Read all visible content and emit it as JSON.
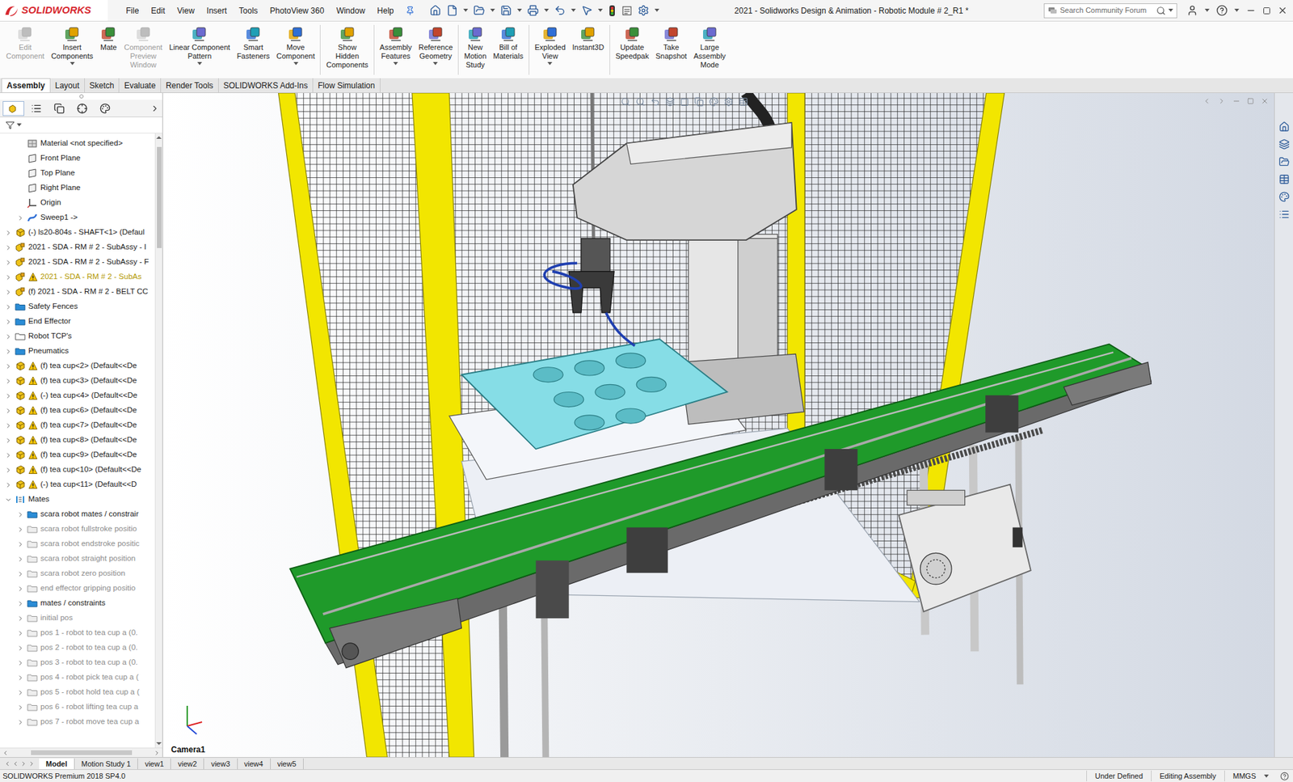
{
  "app": {
    "logo": "SOLIDWORKS"
  },
  "menu": [
    "File",
    "Edit",
    "View",
    "Insert",
    "Tools",
    "PhotoView 360",
    "Window",
    "Help"
  ],
  "window": {
    "title": "2021 - Solidworks Design & Animation - Robotic Module # 2_R1 *"
  },
  "search": {
    "placeholder": "Search Community Forum"
  },
  "ribbon": [
    {
      "lines": [
        "Edit",
        "Component"
      ],
      "disabled": true,
      "has_menu": false,
      "group_start": false
    },
    {
      "lines": [
        "Insert",
        "Components"
      ],
      "disabled": false,
      "has_menu": true,
      "group_start": false
    },
    {
      "lines": [
        "Mate"
      ],
      "disabled": false,
      "has_menu": false,
      "group_start": false
    },
    {
      "lines": [
        "Component",
        "Preview",
        "Window"
      ],
      "disabled": true,
      "has_menu": false,
      "group_start": false
    },
    {
      "lines": [
        "Linear Component",
        "Pattern"
      ],
      "disabled": false,
      "has_menu": true,
      "group_start": false
    },
    {
      "lines": [
        "Smart",
        "Fasteners"
      ],
      "disabled": false,
      "has_menu": false,
      "group_start": false
    },
    {
      "lines": [
        "Move",
        "Component"
      ],
      "disabled": false,
      "has_menu": true,
      "group_start": false
    },
    {
      "lines": [
        "Show",
        "Hidden",
        "Components"
      ],
      "disabled": false,
      "has_menu": false,
      "group_start": true
    },
    {
      "lines": [
        "Assembly",
        "Features"
      ],
      "disabled": false,
      "has_menu": true,
      "group_start": true
    },
    {
      "lines": [
        "Reference",
        "Geometry"
      ],
      "disabled": false,
      "has_menu": true,
      "group_start": false
    },
    {
      "lines": [
        "New",
        "Motion",
        "Study"
      ],
      "disabled": false,
      "has_menu": false,
      "group_start": true
    },
    {
      "lines": [
        "Bill of",
        "Materials"
      ],
      "disabled": false,
      "has_menu": false,
      "group_start": false
    },
    {
      "lines": [
        "Exploded",
        "View"
      ],
      "disabled": false,
      "has_menu": true,
      "group_start": true
    },
    {
      "lines": [
        "Instant3D"
      ],
      "disabled": false,
      "has_menu": false,
      "group_start": false
    },
    {
      "lines": [
        "Update",
        "Speedpak"
      ],
      "disabled": false,
      "has_menu": false,
      "group_start": true
    },
    {
      "lines": [
        "Take",
        "Snapshot"
      ],
      "disabled": false,
      "has_menu": false,
      "group_start": false
    },
    {
      "lines": [
        "Large",
        "Assembly",
        "Mode"
      ],
      "disabled": false,
      "has_menu": false,
      "group_start": false
    }
  ],
  "command_tabs": [
    {
      "label": "Assembly",
      "selected": true
    },
    {
      "label": "Layout",
      "selected": false
    },
    {
      "label": "Sketch",
      "selected": false
    },
    {
      "label": "Evaluate",
      "selected": false
    },
    {
      "label": "Render Tools",
      "selected": false
    },
    {
      "label": "SOLIDWORKS Add-Ins",
      "selected": false
    },
    {
      "label": "Flow Simulation",
      "selected": false
    }
  ],
  "panel_tabs": [
    {
      "selected": true
    },
    {
      "selected": false
    },
    {
      "selected": false
    },
    {
      "selected": false
    },
    {
      "selected": false
    }
  ],
  "tree": [
    {
      "label": "Material <not specified>",
      "kind": "material",
      "level": 1,
      "expander": "none",
      "warning": false,
      "suppressed": false,
      "warn_text": false
    },
    {
      "label": "Front Plane",
      "kind": "plane",
      "level": 1,
      "expander": "none",
      "warning": false,
      "suppressed": false,
      "warn_text": false
    },
    {
      "label": "Top Plane",
      "kind": "plane",
      "level": 1,
      "expander": "none",
      "warning": false,
      "suppressed": false,
      "warn_text": false
    },
    {
      "label": "Right Plane",
      "kind": "plane",
      "level": 1,
      "expander": "none",
      "warning": false,
      "suppressed": false,
      "warn_text": false
    },
    {
      "label": "Origin",
      "kind": "origin",
      "level": 1,
      "expander": "none",
      "warning": false,
      "suppressed": false,
      "warn_text": false
    },
    {
      "label": "Sweep1 ->",
      "kind": "sweep",
      "level": 1,
      "expander": "collapsed",
      "warning": false,
      "suppressed": false,
      "warn_text": false
    },
    {
      "label": "(-) ls20-804s - SHAFT<1> (Defaul",
      "kind": "part",
      "level": 0,
      "expander": "collapsed",
      "warning": false,
      "suppressed": false,
      "warn_text": false
    },
    {
      "label": "2021 - SDA - RM # 2 - SubAssy - I",
      "kind": "assembly",
      "level": 0,
      "expander": "collapsed",
      "warning": false,
      "suppressed": false,
      "warn_text": false
    },
    {
      "label": "2021 - SDA - RM # 2 - SubAssy - F",
      "kind": "assembly",
      "level": 0,
      "expander": "collapsed",
      "warning": false,
      "suppressed": false,
      "warn_text": false
    },
    {
      "label": "2021 - SDA - RM # 2 - SubAs",
      "kind": "assembly",
      "level": 0,
      "expander": "collapsed",
      "warning": true,
      "suppressed": false,
      "warn_text": true
    },
    {
      "label": "(f) 2021 - SDA - RM # 2 - BELT CC",
      "kind": "assembly",
      "level": 0,
      "expander": "collapsed",
      "warning": false,
      "suppressed": false,
      "warn_text": false
    },
    {
      "label": "Safety Fences",
      "kind": "folder",
      "level": 0,
      "expander": "collapsed",
      "warning": false,
      "suppressed": false,
      "warn_text": false
    },
    {
      "label": "End Effector",
      "kind": "folder",
      "level": 0,
      "expander": "collapsed",
      "warning": false,
      "suppressed": false,
      "warn_text": false
    },
    {
      "label": "Robot TCP's",
      "kind": "folder-empty",
      "level": 0,
      "expander": "collapsed",
      "warning": false,
      "suppressed": false,
      "warn_text": false
    },
    {
      "label": "Pneumatics",
      "kind": "folder",
      "level": 0,
      "expander": "collapsed",
      "warning": false,
      "suppressed": false,
      "warn_text": false
    },
    {
      "label": "(f) tea cup<2> (Default<<De",
      "kind": "part",
      "level": 0,
      "expander": "collapsed",
      "warning": true,
      "suppressed": false,
      "warn_text": false
    },
    {
      "label": "(f) tea cup<3> (Default<<De",
      "kind": "part",
      "level": 0,
      "expander": "collapsed",
      "warning": true,
      "suppressed": false,
      "warn_text": false
    },
    {
      "label": "(-) tea cup<4> (Default<<De",
      "kind": "part",
      "level": 0,
      "expander": "collapsed",
      "warning": true,
      "suppressed": false,
      "warn_text": false
    },
    {
      "label": "(f) tea cup<6> (Default<<De",
      "kind": "part",
      "level": 0,
      "expander": "collapsed",
      "warning": true,
      "suppressed": false,
      "warn_text": false
    },
    {
      "label": "(f) tea cup<7> (Default<<De",
      "kind": "part",
      "level": 0,
      "expander": "collapsed",
      "warning": true,
      "suppressed": false,
      "warn_text": false
    },
    {
      "label": "(f) tea cup<8> (Default<<De",
      "kind": "part",
      "level": 0,
      "expander": "collapsed",
      "warning": true,
      "suppressed": false,
      "warn_text": false
    },
    {
      "label": "(f) tea cup<9> (Default<<De",
      "kind": "part",
      "level": 0,
      "expander": "collapsed",
      "warning": true,
      "suppressed": false,
      "warn_text": false
    },
    {
      "label": "(f) tea cup<10> (Default<<De",
      "kind": "part",
      "level": 0,
      "expander": "collapsed",
      "warning": true,
      "suppressed": false,
      "warn_text": false
    },
    {
      "label": "(-) tea cup<11> (Default<<D",
      "kind": "part",
      "level": 0,
      "expander": "collapsed",
      "warning": true,
      "suppressed": false,
      "warn_text": false
    },
    {
      "label": "Mates",
      "kind": "mates",
      "level": 0,
      "expander": "expanded",
      "warning": false,
      "suppressed": false,
      "warn_text": false
    },
    {
      "label": "scara robot mates / constrair",
      "kind": "mate-folder",
      "level": 1,
      "expander": "collapsed",
      "warning": false,
      "suppressed": false,
      "warn_text": false
    },
    {
      "label": "scara robot fullstroke positio",
      "kind": "mate-folder-off",
      "level": 1,
      "expander": "collapsed",
      "warning": false,
      "suppressed": true,
      "warn_text": false
    },
    {
      "label": "scara robot endstroke positic",
      "kind": "mate-folder-off",
      "level": 1,
      "expander": "collapsed",
      "warning": false,
      "suppressed": true,
      "warn_text": false
    },
    {
      "label": "scara robot straight position",
      "kind": "mate-folder-off",
      "level": 1,
      "expander": "collapsed",
      "warning": false,
      "suppressed": true,
      "warn_text": false
    },
    {
      "label": "scara robot zero position",
      "kind": "mate-folder-off",
      "level": 1,
      "expander": "collapsed",
      "warning": false,
      "suppressed": true,
      "warn_text": false
    },
    {
      "label": "end effector gripping positio",
      "kind": "mate-folder-off",
      "level": 1,
      "expander": "collapsed",
      "warning": false,
      "suppressed": true,
      "warn_text": false
    },
    {
      "label": "mates / constraints",
      "kind": "mate-folder",
      "level": 1,
      "expander": "collapsed",
      "warning": false,
      "suppressed": false,
      "warn_text": false
    },
    {
      "label": "initial pos",
      "kind": "mate-folder-off",
      "level": 1,
      "expander": "collapsed",
      "warning": false,
      "suppressed": true,
      "warn_text": false
    },
    {
      "label": "pos 1 - robot to tea cup a (0.",
      "kind": "mate-folder-off",
      "level": 1,
      "expander": "collapsed",
      "warning": false,
      "suppressed": true,
      "warn_text": false
    },
    {
      "label": "pos 2 - robot to tea cup a (0.",
      "kind": "mate-folder-off",
      "level": 1,
      "expander": "collapsed",
      "warning": false,
      "suppressed": true,
      "warn_text": false
    },
    {
      "label": "pos 3 - robot to tea cup a (0.",
      "kind": "mate-folder-off",
      "level": 1,
      "expander": "collapsed",
      "warning": false,
      "suppressed": true,
      "warn_text": false
    },
    {
      "label": "pos 4 - robot pick tea cup a (",
      "kind": "mate-folder-off",
      "level": 1,
      "expander": "collapsed",
      "warning": false,
      "suppressed": true,
      "warn_text": false
    },
    {
      "label": "pos 5 - robot hold tea cup a (",
      "kind": "mate-folder-off",
      "level": 1,
      "expander": "collapsed",
      "warning": false,
      "suppressed": true,
      "warn_text": false
    },
    {
      "label": "pos 6 - robot lifting tea cup a",
      "kind": "mate-folder-off",
      "level": 1,
      "expander": "collapsed",
      "warning": false,
      "suppressed": true,
      "warn_text": false
    },
    {
      "label": "pos 7 - robot move tea cup a",
      "kind": "mate-folder-off",
      "level": 1,
      "expander": "collapsed",
      "warning": false,
      "suppressed": true,
      "warn_text": false
    }
  ],
  "viewport": {
    "view_label": "Camera1"
  },
  "bottom_tabs": [
    {
      "label": "Model",
      "selected": true
    },
    {
      "label": "Motion Study 1",
      "selected": false
    },
    {
      "label": "view1",
      "selected": false
    },
    {
      "label": "view2",
      "selected": false
    },
    {
      "label": "view3",
      "selected": false
    },
    {
      "label": "view4",
      "selected": false
    },
    {
      "label": "view5",
      "selected": false
    }
  ],
  "status_bar": {
    "product": "SOLIDWORKS Premium 2018 SP4.0",
    "items": [
      "Under Defined",
      "Editing Assembly",
      "MMGS"
    ]
  }
}
